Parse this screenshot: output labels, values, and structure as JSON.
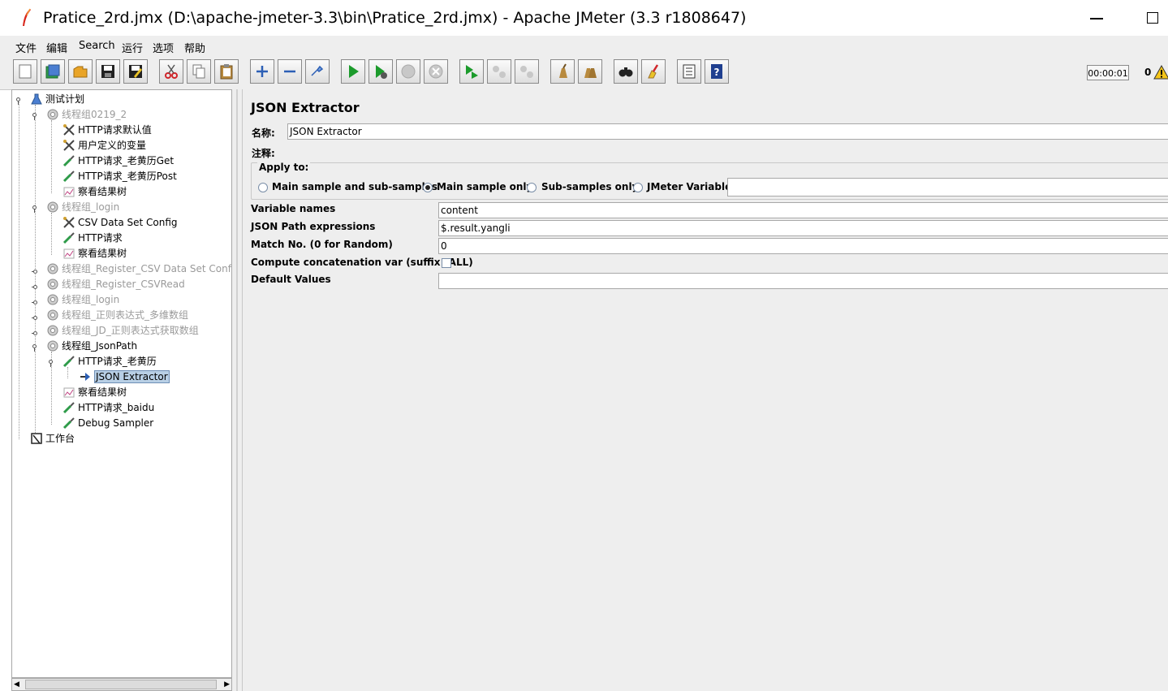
{
  "window": {
    "title": "Pratice_2rd.jmx (D:\\apache-jmeter-3.3\\bin\\Pratice_2rd.jmx) - Apache JMeter (3.3 r1808647)"
  },
  "menu": [
    "文件",
    "编辑",
    "Search",
    "运行",
    "选项",
    "帮助"
  ],
  "toolbar": {
    "timer": "00:00:01",
    "error_count": "0",
    "buttons": [
      "new-icon",
      "templates-icon",
      "open-icon",
      "save-icon",
      "save-as-icon",
      "cut-icon",
      "copy-icon",
      "paste-icon",
      "expand-icon",
      "collapse-icon",
      "toggle-icon",
      "start-icon",
      "start-no-pause-icon",
      "stop-icon",
      "shutdown-icon",
      "remote-start-icon",
      "remote-stop-icon",
      "remote-shutdown-icon",
      "clear-icon",
      "clear-all-icon",
      "search-icon",
      "reset-search-icon",
      "function-helper-icon",
      "help-icon"
    ]
  },
  "tree": {
    "items": [
      {
        "label": "测试计划",
        "icon": "test-plan-icon",
        "disabled": false
      },
      {
        "label": "线程组0219_2",
        "icon": "thread-group-icon",
        "disabled": true
      },
      {
        "label": "HTTP请求默认值",
        "icon": "config-icon",
        "disabled": false
      },
      {
        "label": "用户定义的变量",
        "icon": "config-icon",
        "disabled": false
      },
      {
        "label": "HTTP请求_老黄历Get",
        "icon": "sampler-icon",
        "disabled": false
      },
      {
        "label": "HTTP请求_老黄历Post",
        "icon": "sampler-icon",
        "disabled": false
      },
      {
        "label": "察看结果树",
        "icon": "listener-icon",
        "disabled": false
      },
      {
        "label": "线程组_login",
        "icon": "thread-group-icon",
        "disabled": true
      },
      {
        "label": "CSV Data Set Config",
        "icon": "config-icon",
        "disabled": false
      },
      {
        "label": "HTTP请求",
        "icon": "sampler-icon",
        "disabled": false
      },
      {
        "label": "察看结果树",
        "icon": "listener-icon",
        "disabled": false
      },
      {
        "label": "线程组_Register_CSV Data Set Config",
        "icon": "thread-group-icon",
        "disabled": true
      },
      {
        "label": "线程组_Register_CSVRead",
        "icon": "thread-group-icon",
        "disabled": true
      },
      {
        "label": "线程组_login",
        "icon": "thread-group-icon",
        "disabled": true
      },
      {
        "label": "线程组_正则表达式_多维数组",
        "icon": "thread-group-icon",
        "disabled": true
      },
      {
        "label": "线程组_JD_正则表达式获取数组",
        "icon": "thread-group-icon",
        "disabled": true
      },
      {
        "label": "线程组_JsonPath",
        "icon": "thread-group-icon",
        "disabled": false
      },
      {
        "label": "HTTP请求_老黄历",
        "icon": "sampler-icon",
        "disabled": false
      },
      {
        "label": "JSON Extractor",
        "icon": "post-processor-icon",
        "disabled": false,
        "selected": true
      },
      {
        "label": "察看结果树",
        "icon": "listener-icon",
        "disabled": false
      },
      {
        "label": "HTTP请求_baidu",
        "icon": "sampler-icon",
        "disabled": false
      },
      {
        "label": "Debug Sampler",
        "icon": "sampler-icon",
        "disabled": false
      },
      {
        "label": "工作台",
        "icon": "workbench-icon",
        "disabled": false
      }
    ]
  },
  "panel": {
    "title": "JSON Extractor",
    "name_label": "名称:",
    "name_value": "JSON Extractor",
    "comment_label": "注释:",
    "comment_value": "",
    "apply_to": {
      "legend": "Apply to:",
      "options": [
        "Main sample and sub-samples",
        "Main sample only",
        "Sub-samples only",
        "JMeter Variable"
      ],
      "selected": "Main sample only",
      "jmeter_variable_value": ""
    },
    "fields": [
      {
        "label": "Variable names",
        "value": "content"
      },
      {
        "label": "JSON Path expressions",
        "value": "$.result.yangli"
      },
      {
        "label": "Match No. (0 for Random)",
        "value": "0"
      },
      {
        "label": "Compute concatenation var (suffix _ALL)",
        "checkbox": false
      },
      {
        "label": "Default Values",
        "value": ""
      }
    ]
  }
}
